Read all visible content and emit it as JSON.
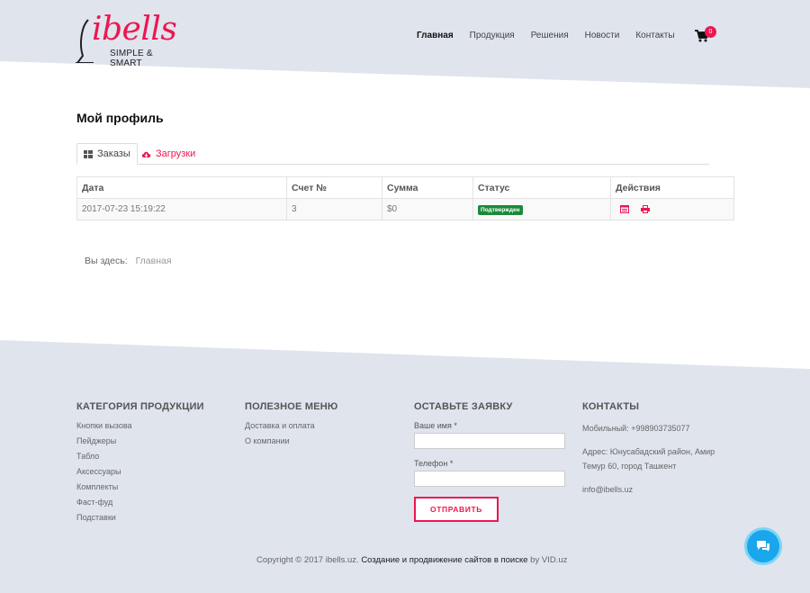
{
  "brand": {
    "name": "ibells",
    "tagline": "SIMPLE & SMART",
    "accent": "#ed1651",
    "bg": "#dfe4ed"
  },
  "nav": {
    "items": [
      {
        "label": "Главная",
        "active": true
      },
      {
        "label": "Продукция"
      },
      {
        "label": "Решения"
      },
      {
        "label": "Новости"
      },
      {
        "label": "Контакты"
      }
    ],
    "cart_count": "0"
  },
  "page": {
    "title": "Мой профиль",
    "tabs": {
      "orders": "Заказы",
      "downloads": "Загрузки"
    },
    "table": {
      "headers": [
        "Дата",
        "Счет №",
        "Сумма",
        "Статус",
        "Действия"
      ],
      "rows": [
        {
          "date": "2017-07-23 15:19:22",
          "invoice": "3",
          "amount": "$0",
          "status": "Подтвержден",
          "status_color": "#1a8a3a"
        }
      ]
    },
    "breadcrumb": {
      "label": "Вы здесь:",
      "current": "Главная"
    }
  },
  "footer": {
    "categories": {
      "title": "КАТЕГОРИЯ ПРОДУКЦИИ",
      "items": [
        "Кнопки вызова",
        "Пейджеры",
        "Табло",
        "Аксессуары",
        "Комплекты",
        "Фаст-фуд",
        "Подставки"
      ]
    },
    "useful": {
      "title": "ПОЛЕЗНОЕ МЕНЮ",
      "items": [
        "Доставка и оплата",
        "О компании"
      ]
    },
    "request": {
      "title": "ОСТАВЬТЕ ЗАЯВКУ",
      "name_label": "Ваше имя *",
      "phone_label": "Телефон *",
      "submit": "ОТПРАВИТЬ"
    },
    "contacts": {
      "title": "КОНТАКТЫ",
      "phone": "Мобильный: +998903735077",
      "address": "Адрес: Юнусабадский район, Амир Темур 60, город Ташкент",
      "email": "info@ibells.uz"
    },
    "copyright": {
      "prefix": "Copyright © 2017 ibells.uz.",
      "link": "Создание и продвижение сайтов в поиске",
      "suffix": "by VID.uz"
    }
  }
}
